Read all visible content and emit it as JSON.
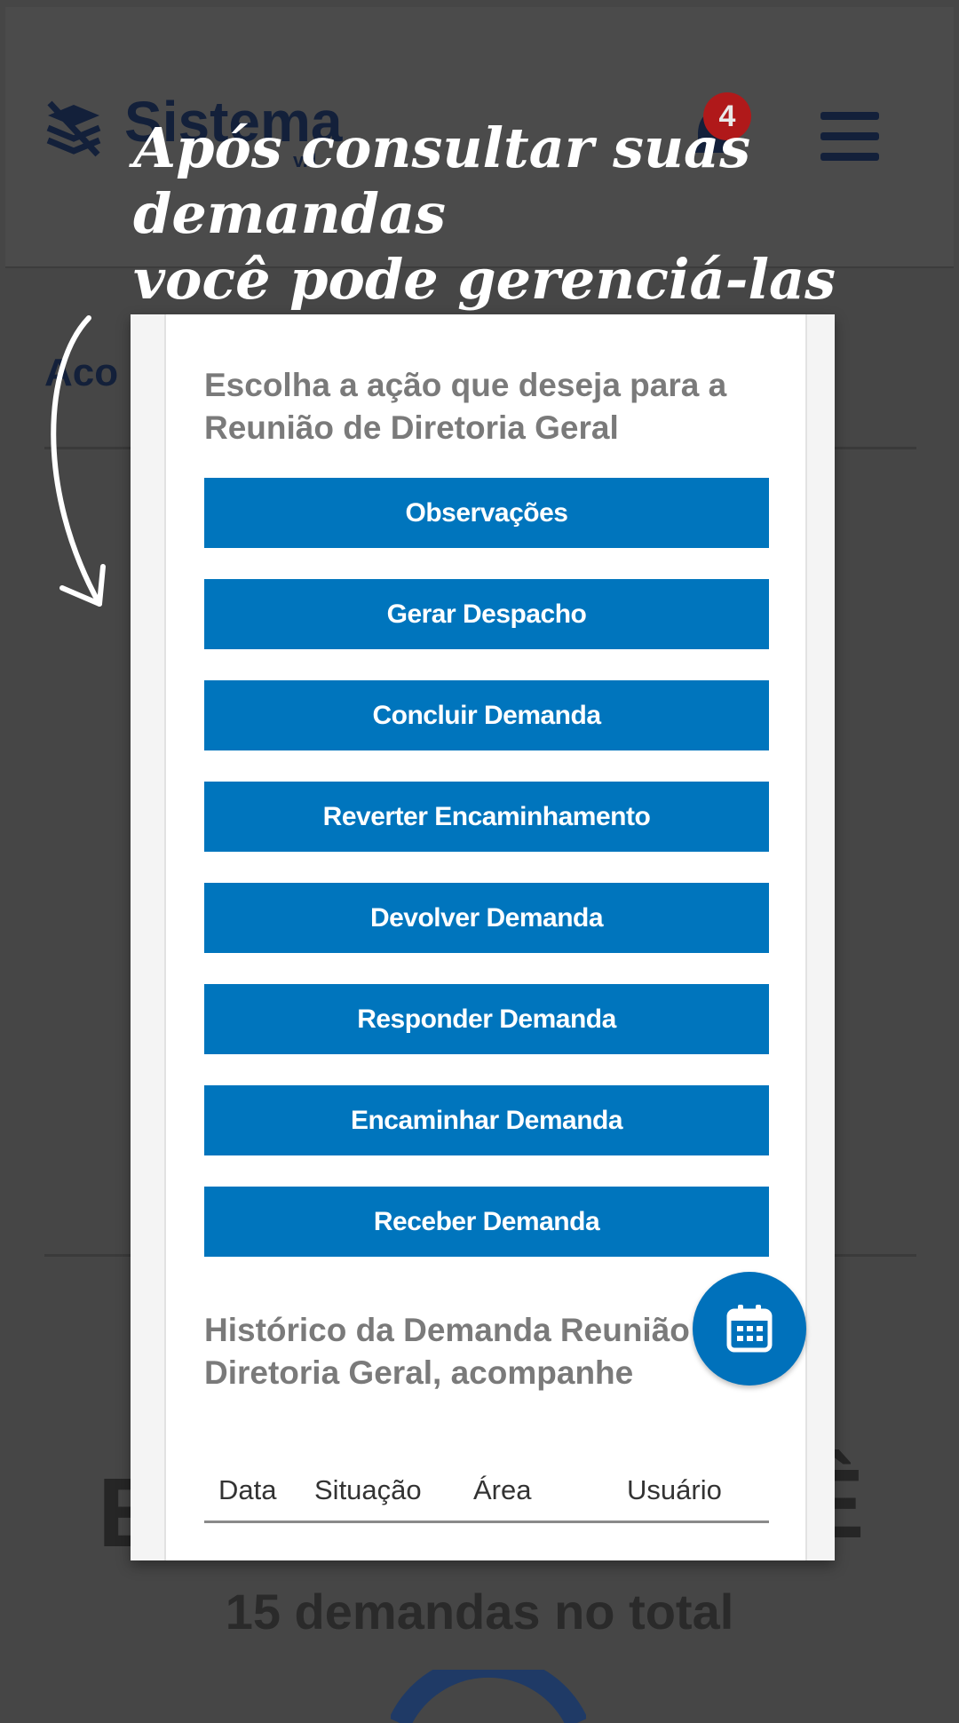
{
  "background": {
    "brand": "Sistema",
    "brand_version": "v.1",
    "notification_count": "4",
    "section_partial": "Aco",
    "big_left": "E",
    "big_right": "Ê",
    "total_text": "15 demandas no total"
  },
  "caption": {
    "line1": "Após consultar suas demandas",
    "line2": "você pode gerenciá-las"
  },
  "panel": {
    "title": "Escolha a ação que deseja para a Reunião de Diretoria Geral",
    "actions": [
      "Observações",
      "Gerar Despacho",
      "Concluir Demanda",
      "Reverter Encaminhamento",
      "Devolver Demanda",
      "Responder Demanda",
      "Encaminhar Demanda",
      "Receber Demanda"
    ],
    "history_title": "Histórico da Demanda Reunião Diretoria Geral, acompanhe",
    "table_headers": [
      "Data",
      "Situação",
      "Área",
      "Usuário"
    ]
  },
  "icons": {
    "logo": "layers-slash-icon",
    "bell": "bell-icon",
    "menu": "hamburger-menu-icon",
    "fab": "calendar-icon",
    "arrow": "curved-arrow-icon"
  },
  "colors": {
    "overlay": "#464646",
    "button": "#0075bd",
    "fab": "#0071bb",
    "badge": "#b0191a"
  }
}
